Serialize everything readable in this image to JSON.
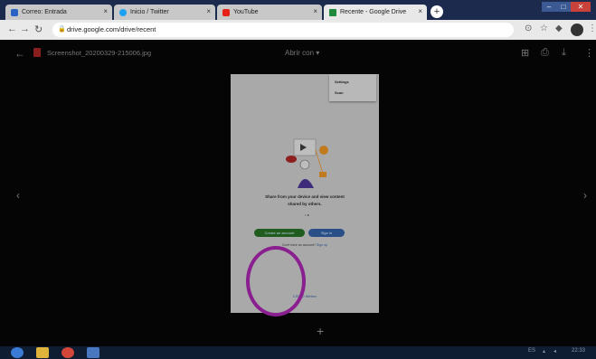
{
  "browser": {
    "tabs": [
      {
        "label": "Correo: Entrada",
        "color": "#2b63c4"
      },
      {
        "label": "Inicio / Twitter",
        "color": "#1da1f2"
      },
      {
        "label": "YouTube",
        "color": "#e62117"
      },
      {
        "label": "Recente - Google Drive",
        "color": "#1f8a3b"
      }
    ],
    "close_glyph": "×",
    "new_tab_glyph": "+",
    "url": "drive.google.com/drive/recent"
  },
  "viewer": {
    "file_name": "Screenshot_20200329-215006.jpg",
    "open_with": "Abrir con",
    "icons": [
      "back-arrow-icon",
      "add-to-drive-icon",
      "print-icon",
      "download-icon",
      "more-icon",
      "prev-icon",
      "next-icon",
      "add-icon"
    ]
  },
  "document": {
    "menu": [
      "Settings",
      "Scan"
    ],
    "promo_line1": "Share from your device and view content",
    "promo_line2": "shared by others.",
    "create_button": "Create an account",
    "signin_button": "Sign in",
    "signup_prefix": "Don't have an account?",
    "signup_link": "Sign up",
    "brand": "CISCO Webex"
  },
  "taskbar": {
    "apps": [
      {
        "name": "start",
        "color": "#3a7bd5"
      },
      {
        "name": "explorer",
        "color": "#e0b43a"
      },
      {
        "name": "chrome",
        "color": "#d44638"
      },
      {
        "name": "word",
        "color": "#4a78c0"
      }
    ],
    "tray_lang": "ES",
    "clock": "22:33"
  }
}
